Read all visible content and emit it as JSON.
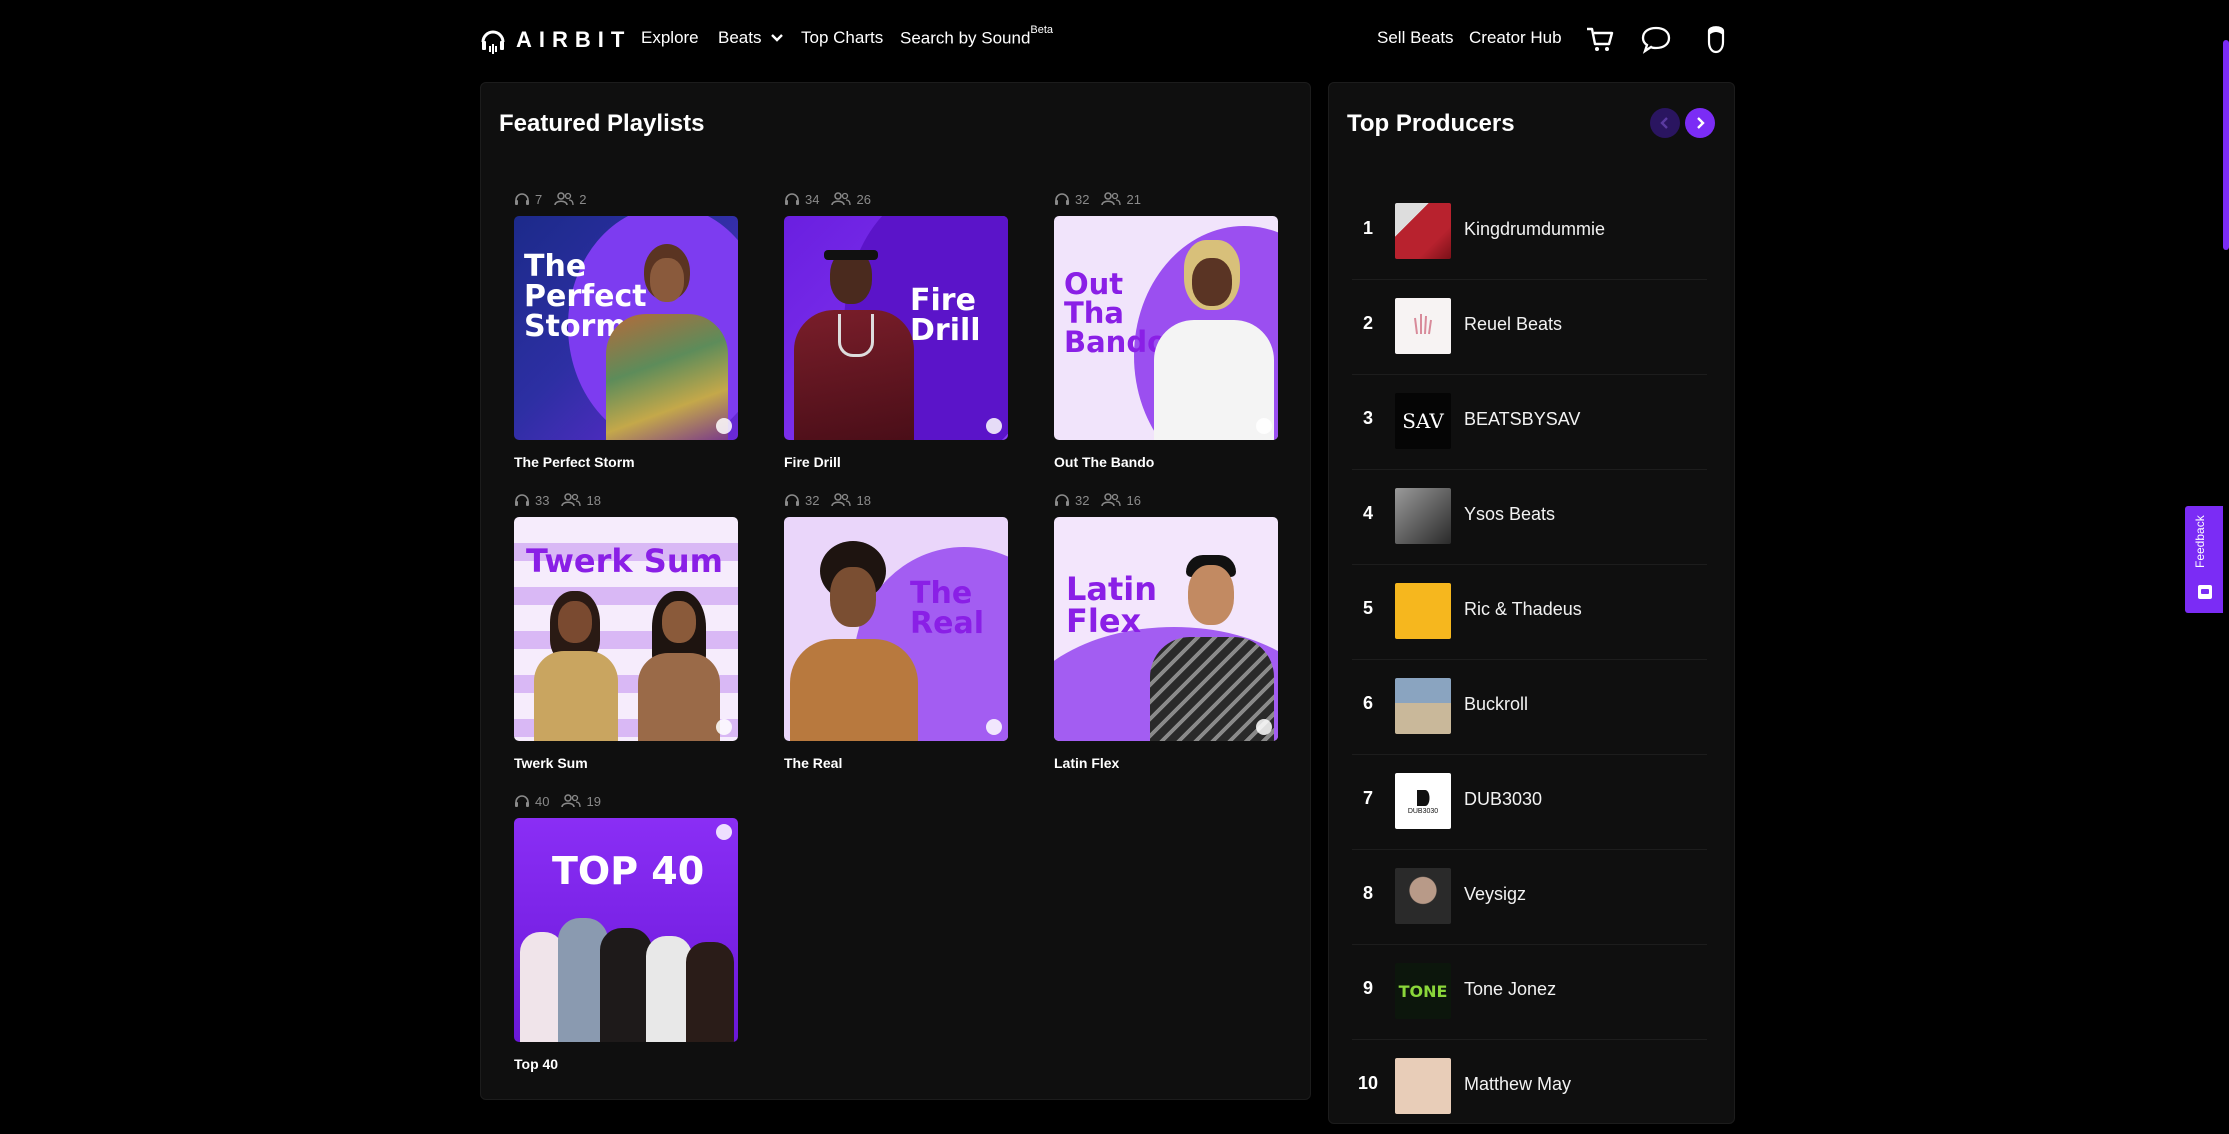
{
  "nav": {
    "logo": "AIRBIT",
    "links": {
      "explore": "Explore",
      "beats": "Beats",
      "top_charts": "Top Charts",
      "search_by_sound": "Search by Sound",
      "beta": "Beta"
    },
    "right": {
      "sell_beats": "Sell Beats",
      "creator_hub": "Creator Hub"
    },
    "icons": [
      "cart-icon",
      "chat-icon",
      "user-icon"
    ]
  },
  "featured": {
    "title": "Featured Playlists",
    "playlists": [
      {
        "name": "The Perfect Storm",
        "plays": "7",
        "followers": "2",
        "cover_title": "The Perfect Storm"
      },
      {
        "name": "Fire Drill",
        "plays": "34",
        "followers": "26",
        "cover_title": "Fire Drill"
      },
      {
        "name": "Out The Bando",
        "plays": "32",
        "followers": "21",
        "cover_title": "Out Tha Bando"
      },
      {
        "name": "Twerk Sum",
        "plays": "33",
        "followers": "18",
        "cover_title": "Twerk Sum"
      },
      {
        "name": "The Real",
        "plays": "32",
        "followers": "18",
        "cover_title": "The Real"
      },
      {
        "name": "Latin Flex",
        "plays": "32",
        "followers": "16",
        "cover_title": "Latin Flex"
      },
      {
        "name": "Top 40",
        "plays": "40",
        "followers": "19",
        "cover_title": "TOP 40"
      }
    ]
  },
  "producers": {
    "title": "Top Producers",
    "items": [
      {
        "rank": "1",
        "name": "Kingdrumdummie"
      },
      {
        "rank": "2",
        "name": "Reuel Beats"
      },
      {
        "rank": "3",
        "name": "BEATSBYSAV"
      },
      {
        "rank": "4",
        "name": "Ysos Beats"
      },
      {
        "rank": "5",
        "name": "Ric & Thadeus"
      },
      {
        "rank": "6",
        "name": "Buckroll"
      },
      {
        "rank": "7",
        "name": "DUB3030"
      },
      {
        "rank": "8",
        "name": "Veysigz"
      },
      {
        "rank": "9",
        "name": "Tone Jonez"
      },
      {
        "rank": "10",
        "name": "Matthew May"
      }
    ],
    "avatar_text": {
      "sav": "SAV",
      "dub": "DUB3030",
      "tone": "TONE"
    }
  },
  "feedback": "Feedback",
  "colors": {
    "accent": "#7b2cf5",
    "panel": "#0f0f0f",
    "bg": "#000000",
    "muted": "#8a8a8a"
  }
}
